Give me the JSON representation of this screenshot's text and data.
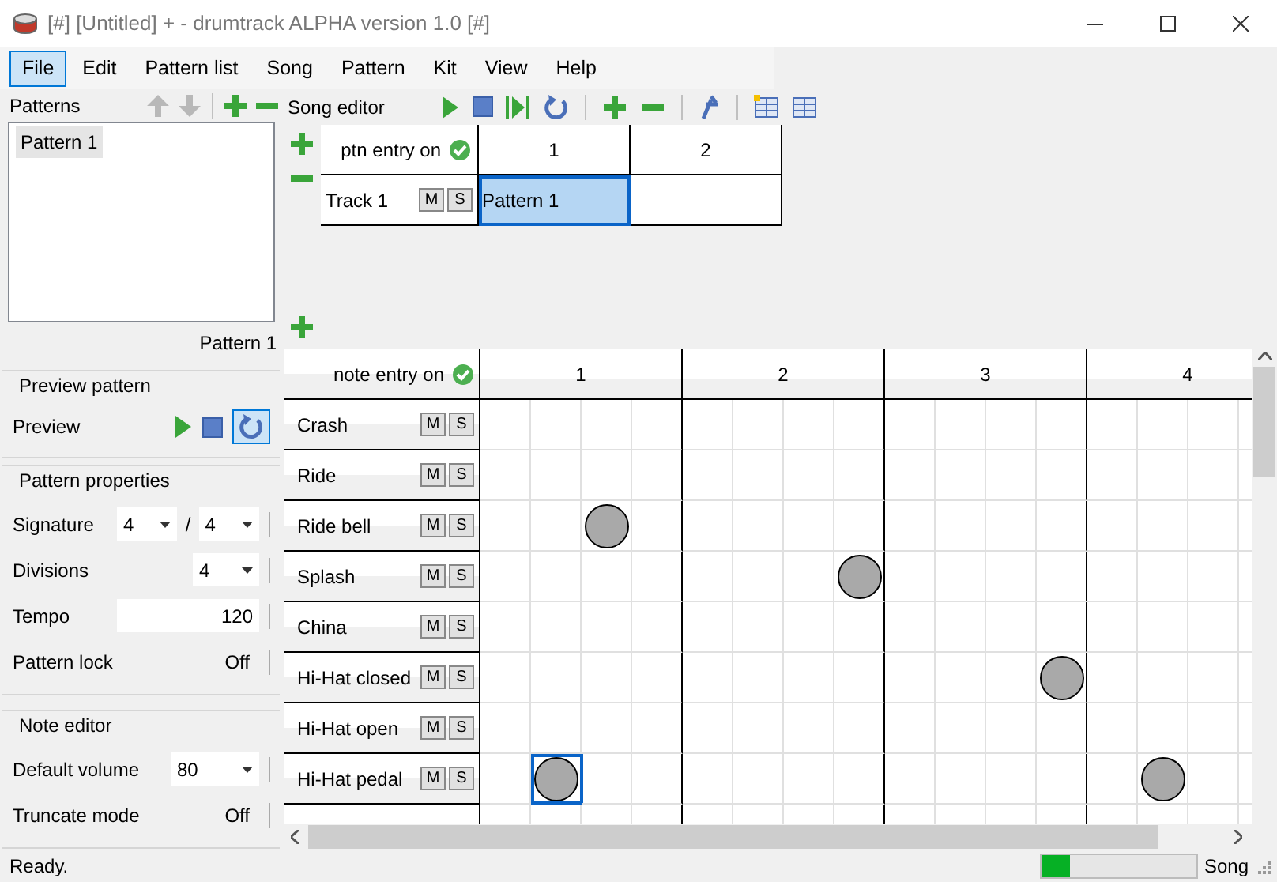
{
  "window": {
    "title": "[#] [Untitled] + - drumtrack ALPHA version 1.0 [#]"
  },
  "menu": [
    {
      "label": "File",
      "selected": true
    },
    {
      "label": "Edit",
      "selected": false
    },
    {
      "label": "Pattern list",
      "selected": false
    },
    {
      "label": "Song",
      "selected": false
    },
    {
      "label": "Pattern",
      "selected": false
    },
    {
      "label": "Kit",
      "selected": false
    },
    {
      "label": "View",
      "selected": false
    },
    {
      "label": "Help",
      "selected": false
    }
  ],
  "patterns": {
    "title": "Patterns",
    "items": [
      {
        "label": "Pattern 1",
        "selected": true
      }
    ],
    "current": "Pattern 1"
  },
  "preview": {
    "title": "Preview pattern",
    "label": "Preview",
    "loop_on": true
  },
  "pattern_properties": {
    "title": "Pattern properties",
    "fields": [
      {
        "kind": "double-combo",
        "label": "Signature",
        "values": [
          "4",
          "4"
        ],
        "separator": "/"
      },
      {
        "kind": "combo",
        "label": "Divisions",
        "value": "4"
      },
      {
        "kind": "number",
        "label": "Tempo",
        "value": "120"
      },
      {
        "kind": "toggle",
        "label": "Pattern lock",
        "value": "Off"
      }
    ]
  },
  "note_editor": {
    "title": "Note editor",
    "fields": [
      {
        "kind": "wide-combo",
        "label": "Default volume",
        "value": "80"
      },
      {
        "kind": "toggle",
        "label": "Truncate mode",
        "value": "Off"
      }
    ]
  },
  "song_editor": {
    "title": "Song editor",
    "entry_label": "ptn entry on",
    "columns": [
      "1",
      "2"
    ],
    "tracks": [
      {
        "name": "Track 1",
        "mute": "M",
        "solo": "S",
        "cells": [
          {
            "text": "Pattern 1",
            "selected": true
          },
          {
            "selected": false
          }
        ]
      }
    ]
  },
  "note_grid": {
    "entry_label": "note entry on",
    "beats": [
      "1",
      "2",
      "3",
      "4"
    ],
    "instruments": [
      {
        "name": "Crash",
        "mute": "M",
        "solo": "S",
        "hits": [
          false,
          false,
          false,
          false,
          false,
          false,
          false,
          false,
          false,
          false,
          false,
          false,
          false,
          false,
          false,
          false
        ]
      },
      {
        "name": "Ride",
        "mute": "M",
        "solo": "S",
        "hits": [
          false,
          false,
          false,
          false,
          false,
          false,
          false,
          false,
          false,
          false,
          false,
          false,
          false,
          false,
          false,
          false
        ]
      },
      {
        "name": "Ride bell",
        "mute": "M",
        "solo": "S",
        "hits": [
          false,
          false,
          true,
          false,
          false,
          false,
          false,
          false,
          false,
          false,
          false,
          false,
          false,
          false,
          false,
          false
        ]
      },
      {
        "name": "Splash",
        "mute": "M",
        "solo": "S",
        "hits": [
          false,
          false,
          false,
          false,
          false,
          false,
          false,
          true,
          false,
          false,
          false,
          false,
          false,
          false,
          false,
          false
        ]
      },
      {
        "name": "China",
        "mute": "M",
        "solo": "S",
        "hits": [
          false,
          false,
          false,
          false,
          false,
          false,
          false,
          false,
          false,
          false,
          false,
          false,
          false,
          false,
          false,
          false
        ]
      },
      {
        "name": "Hi-Hat closed",
        "mute": "M",
        "solo": "S",
        "hits": [
          false,
          false,
          false,
          false,
          false,
          false,
          false,
          false,
          false,
          false,
          false,
          true,
          false,
          false,
          false,
          false
        ]
      },
      {
        "name": "Hi-Hat open",
        "mute": "M",
        "solo": "S",
        "hits": [
          false,
          false,
          false,
          false,
          false,
          false,
          false,
          false,
          false,
          false,
          false,
          false,
          false,
          false,
          false,
          false
        ]
      },
      {
        "name": "Hi-Hat pedal",
        "mute": "M",
        "solo": "S",
        "hits": [
          false,
          true,
          false,
          false,
          false,
          false,
          false,
          false,
          false,
          false,
          false,
          false,
          false,
          true,
          false,
          false
        ],
        "cursor": [
          false,
          true,
          false,
          false,
          false,
          false,
          false,
          false,
          false,
          false,
          false,
          false,
          false,
          false,
          false,
          false
        ]
      }
    ]
  },
  "status_bar": {
    "text": "Ready.",
    "progress": {
      "level": 0.18
    },
    "mode": "Song"
  }
}
